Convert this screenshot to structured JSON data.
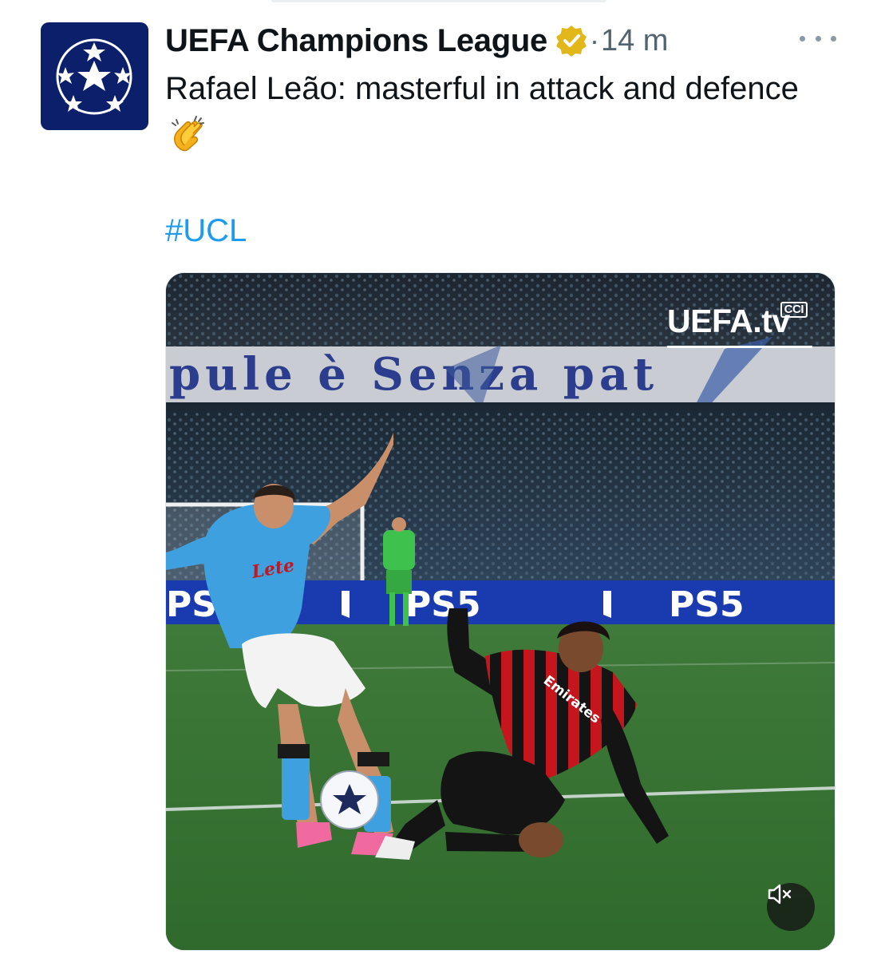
{
  "account": {
    "name": "UEFA Champions League",
    "dot": "·",
    "time": "14 m",
    "avatar_icon": "starball-icon",
    "verified_icon": "verified-badge-icon",
    "verified_color": "#e2b719"
  },
  "tweet": {
    "text": "Rafael Leão: masterful in attack and defence",
    "emoji": "clapping-hands-icon",
    "hashtag": "#UCL"
  },
  "media": {
    "banner_text": "pule è Senza pat",
    "ad_text": "PS5",
    "watermark": "UEFA.tv",
    "watermark_badge": "CCI",
    "jersey_sponsor_home": "Lete",
    "jersey_sponsor_away": "Emirates",
    "mute_icon": "speaker-muted-icon"
  },
  "colors": {
    "link": "#1d9bf0",
    "text": "#0f1419",
    "muted": "#536471",
    "brand_navy": "#0c1f6b"
  }
}
